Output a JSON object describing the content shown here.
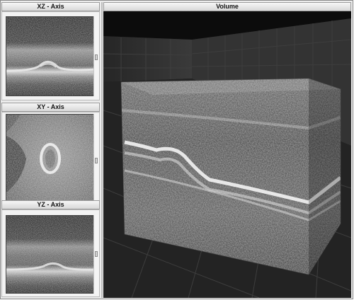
{
  "panels": {
    "xz_title": "XZ - Axis",
    "xy_title": "XY - Axis",
    "yz_title": "YZ - Axis",
    "volume_title": "Volume"
  },
  "sliders": {
    "xz_position": 0.48,
    "xy_position": 0.5,
    "yz_position": 0.46
  },
  "colors": {
    "panel_bg": "#f2f2f2",
    "title_bar": "#d8d8d8",
    "volume_bg": "#1a1a1a",
    "grid": "#3c3c3c"
  }
}
